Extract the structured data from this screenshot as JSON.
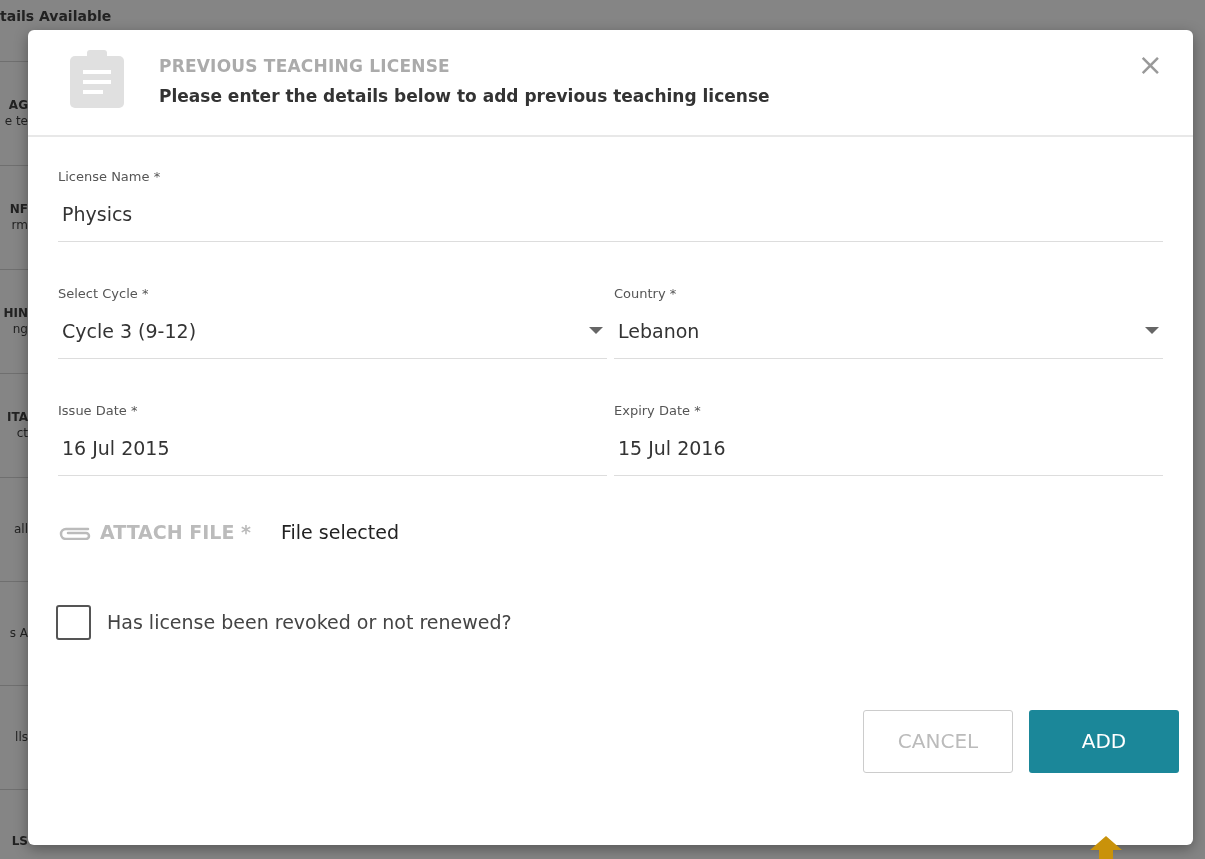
{
  "background_page": {
    "rows": [
      {
        "title": "tails Available"
      },
      {
        "title": "AG",
        "subtitle": "e te"
      },
      {
        "title": "NF",
        "subtitle": "rm"
      },
      {
        "title": "HIN",
        "subtitle": "ng"
      },
      {
        "title": "ITA",
        "subtitle": "ct"
      },
      {
        "subtitle": "all"
      },
      {
        "subtitle": "s A"
      },
      {
        "subtitle": "lls"
      },
      {
        "title": "LS"
      }
    ]
  },
  "dialog": {
    "title": "PREVIOUS TEACHING LICENSE",
    "subtitle": "Please enter the details below to add previous teaching license",
    "close": "×",
    "field_rows": [
      [
        {
          "kind": "text",
          "label": "License Name *",
          "value": "Physics"
        }
      ],
      [
        {
          "kind": "select",
          "label": "Select Cycle *",
          "value": "Cycle 3 (9-12)"
        },
        {
          "kind": "select",
          "label": "Country *",
          "value": "Lebanon"
        }
      ],
      [
        {
          "kind": "text",
          "label": "Issue Date *",
          "value": "16 Jul 2015"
        },
        {
          "kind": "text",
          "label": "Expiry Date *",
          "value": "15 Jul 2016"
        }
      ]
    ],
    "attachment": {
      "label": "ATTACH FILE *",
      "status": "File selected"
    },
    "revoked_checkbox": {
      "label": "Has license been revoked or not renewed?",
      "checked": false
    },
    "buttons": [
      {
        "label": "CANCEL",
        "kind": "secondary"
      },
      {
        "label": "ADD",
        "kind": "primary"
      }
    ]
  }
}
